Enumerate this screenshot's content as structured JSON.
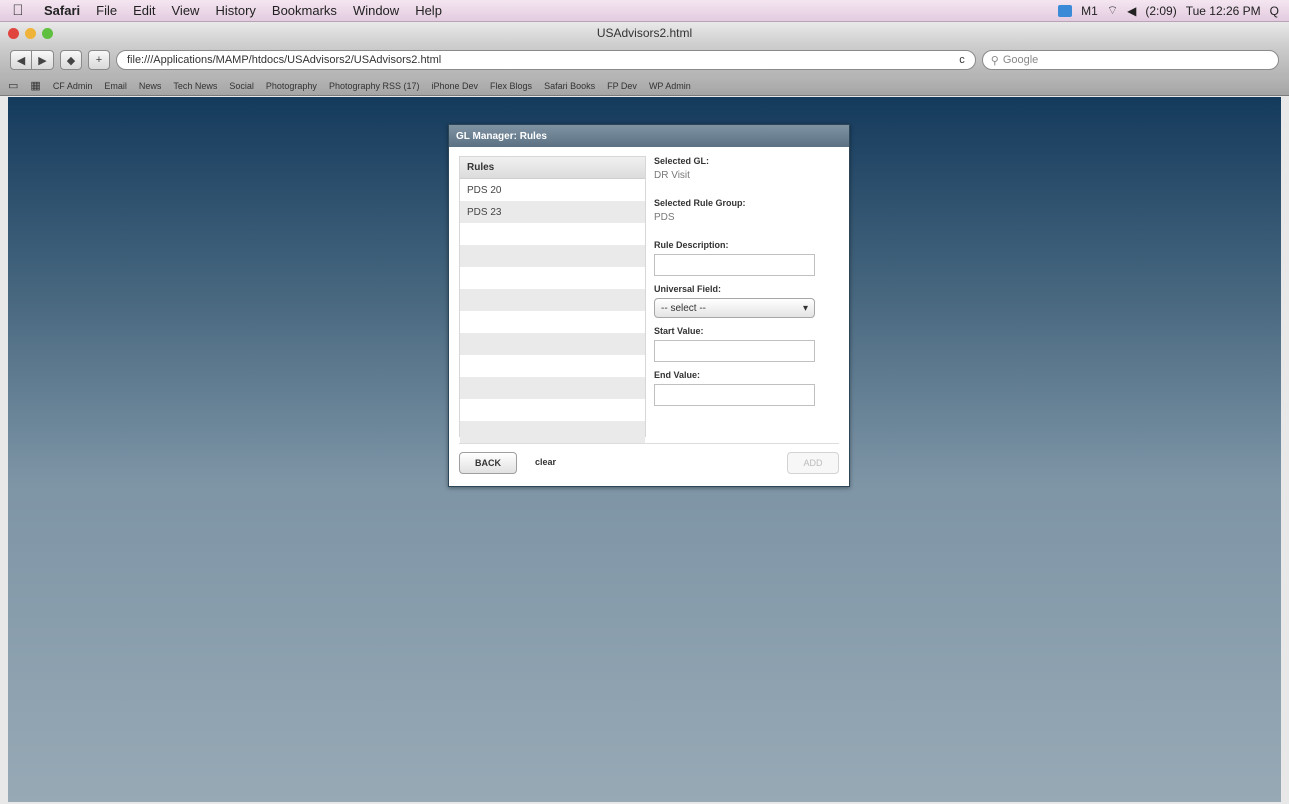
{
  "menubar": {
    "apple_glyph": "",
    "items": [
      "Safari",
      "File",
      "Edit",
      "View",
      "History",
      "Bookmarks",
      "Window",
      "Help"
    ],
    "status": {
      "mail_count": "M1",
      "battery": "(2:09)",
      "clock": "Tue 12:26 PM",
      "search_glyph": "Q"
    }
  },
  "window": {
    "title": "USAdvisors2.html"
  },
  "toolbar": {
    "back_glyph": "◀",
    "forward_glyph": "▶",
    "add_glyph": "+",
    "url": "file:///Applications/MAMP/htdocs/USAdvisors2/USAdvisors2.html",
    "reload_glyph": "c",
    "search_placeholder": "Google"
  },
  "bookmarks": {
    "items": [
      "CF Admin",
      "Email",
      "News",
      "Tech News",
      "Social",
      "Photography",
      "Photography RSS (17)",
      "iPhone Dev",
      "Flex Blogs",
      "Safari Books",
      "FP Dev",
      "WP Admin"
    ]
  },
  "panel": {
    "title": "GL Manager: Rules",
    "rules_header": "Rules",
    "rules": [
      "PDS 20",
      "PDS 23",
      "",
      "",
      "",
      "",
      "",
      "",
      "",
      "",
      "",
      ""
    ],
    "selected_gl_label": "Selected GL:",
    "selected_gl_value": "DR Visit",
    "selected_group_label": "Selected Rule Group:",
    "selected_group_value": "PDS",
    "rule_description_label": "Rule Description:",
    "universal_field_label": "Universal Field:",
    "universal_field_value": "-- select --",
    "start_value_label": "Start Value:",
    "end_value_label": "End Value:",
    "back_label": "BACK",
    "clear_label": "clear",
    "add_label": "ADD"
  }
}
